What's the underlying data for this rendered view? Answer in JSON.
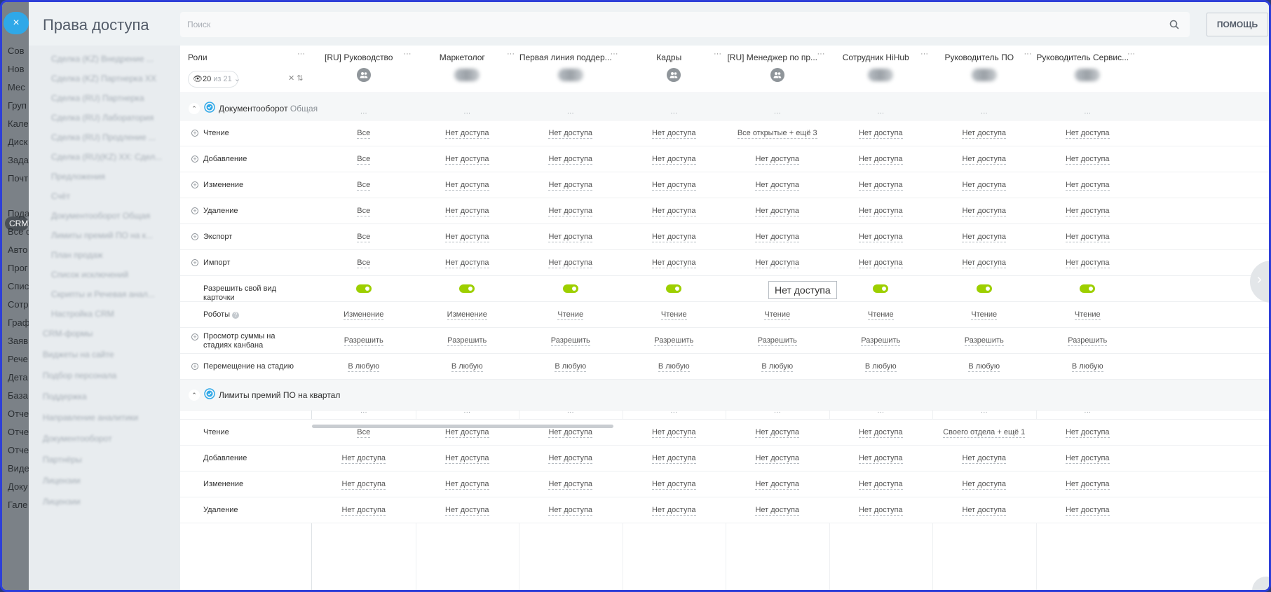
{
  "left_app": {
    "close_label": "×",
    "items": [
      "Сов",
      "Нов",
      "Мес",
      "Груп",
      "Кале",
      "Диск",
      "Зада",
      "Почт",
      "Пода",
      "Все с",
      "Авто",
      "Прог",
      "Спис",
      "Сотр",
      "Граф",
      "Заяв",
      "Рече",
      "Дета",
      "База",
      "Отче",
      "Отче",
      "Отче",
      "Виде",
      "Доку",
      "Гале"
    ],
    "crm_badge": "CRM"
  },
  "panel": {
    "title": "Права доступа"
  },
  "search": {
    "placeholder": "Поиск"
  },
  "help_button": "ПОМОЩЬ",
  "menu": {
    "items": [
      "Сделка (KZ) Внедрение ...",
      "Сделка (KZ) Партнерка XX",
      "Сделка (RU) Партнерка",
      "Сделка (RU) Лаборатория",
      "Сделка (RU) Продление ...",
      "Сделка (RU)(KZ) XX: Сдел...",
      "Предложения",
      "Счёт",
      "Документооборот Общая",
      "Лимиты премий ПО на к...",
      "План продаж",
      "Список исключений",
      "Скрипты и Речевая анал...",
      "Настройка CRM"
    ],
    "top_items": [
      "CRM-формы",
      "Виджеты на сайте",
      "Подбор персонала",
      "Поддержка",
      "Направление аналитики",
      "Документооборот",
      "Партнёры",
      "Лицензии",
      "Лицензии"
    ]
  },
  "table": {
    "roles_title": "Роли",
    "filter": {
      "count": "20",
      "of_label": "из 21"
    },
    "columns": [
      {
        "name": "[RU] Руководство",
        "avatar": "group"
      },
      {
        "name": "Маркетолог",
        "avatar": "blur"
      },
      {
        "name": "Первая линия поддер...",
        "avatar": "blur"
      },
      {
        "name": "Кадры",
        "avatar": "group"
      },
      {
        "name": "[RU] Менеджер по пр...",
        "avatar": "group"
      },
      {
        "name": "Сотрудник HiHub",
        "avatar": "blur"
      },
      {
        "name": "Руководитель ПО",
        "avatar": "blur"
      },
      {
        "name": "Руководитель Сервис...",
        "avatar": "blur"
      }
    ],
    "sections": [
      {
        "title": "Документооборот",
        "subtitle": "Общая",
        "rows": [
          {
            "label": "Чтение",
            "expandable": true,
            "values": [
              "Все",
              "Нет доступа",
              "Нет доступа",
              "Нет доступа",
              "Все открытые + ещё 3",
              "Нет доступа",
              "Нет доступа",
              "Нет доступа"
            ]
          },
          {
            "label": "Добавление",
            "expandable": true,
            "values": [
              "Все",
              "Нет доступа",
              "Нет доступа",
              "Нет доступа",
              "Нет доступа",
              "Нет доступа",
              "Нет доступа",
              "Нет доступа"
            ]
          },
          {
            "label": "Изменение",
            "expandable": true,
            "values": [
              "Все",
              "Нет доступа",
              "Нет доступа",
              "Нет доступа",
              "Нет доступа",
              "Нет доступа",
              "Нет доступа",
              "Нет доступа"
            ]
          },
          {
            "label": "Удаление",
            "expandable": true,
            "values": [
              "Все",
              "Нет доступа",
              "Нет доступа",
              "Нет доступа",
              "Нет доступа",
              "Нет доступа",
              "Нет доступа",
              "Нет доступа"
            ]
          },
          {
            "label": "Экспорт",
            "expandable": true,
            "values": [
              "Все",
              "Нет доступа",
              "Нет доступа",
              "Нет доступа",
              "Нет доступа",
              "Нет доступа",
              "Нет доступа",
              "Нет доступа"
            ]
          },
          {
            "label": "Импорт",
            "expandable": true,
            "values": [
              "Все",
              "Нет доступа",
              "Нет доступа",
              "Нет доступа",
              "Нет доступа",
              "Нет доступа",
              "Нет доступа",
              "Нет доступа"
            ]
          },
          {
            "label": "Разрешить свой вид карточки",
            "expandable": false,
            "toggle": true,
            "values": [
              "on",
              "on",
              "on",
              "on",
              "on",
              "on",
              "on",
              "on"
            ]
          },
          {
            "label": "Роботы",
            "expandable": false,
            "help": "?",
            "values": [
              "Изменение",
              "Изменение",
              "Чтение",
              "Чтение",
              "Чтение",
              "Чтение",
              "Чтение",
              "Чтение"
            ]
          },
          {
            "label": "Просмотр суммы на стадиях канбана",
            "expandable": true,
            "values": [
              "Разрешить",
              "Разрешить",
              "Разрешить",
              "Разрешить",
              "Разрешить",
              "Разрешить",
              "Разрешить",
              "Разрешить"
            ]
          },
          {
            "label": "Перемещение на стадию",
            "expandable": true,
            "values": [
              "В любую",
              "В любую",
              "В любую",
              "В любую",
              "В любую",
              "В любую",
              "В любую",
              "В любую"
            ]
          }
        ]
      },
      {
        "title": "Лимиты премий ПО на квартал",
        "subtitle": "",
        "rows": [
          {
            "label": "Чтение",
            "expandable": false,
            "values": [
              "Все",
              "Нет доступа",
              "Нет доступа",
              "Нет доступа",
              "Нет доступа",
              "Нет доступа",
              "Своего отдела + ещё 1",
              "Нет доступа"
            ]
          },
          {
            "label": "Добавление",
            "expandable": false,
            "values": [
              "Нет доступа",
              "Нет доступа",
              "Нет доступа",
              "Нет доступа",
              "Нет доступа",
              "Нет доступа",
              "Нет доступа",
              "Нет доступа"
            ]
          },
          {
            "label": "Изменение",
            "expandable": false,
            "values": [
              "Нет доступа",
              "Нет доступа",
              "Нет доступа",
              "Нет доступа",
              "Нет доступа",
              "Нет доступа",
              "Нет доступа",
              "Нет доступа"
            ]
          },
          {
            "label": "Удаление",
            "expandable": false,
            "values": [
              "Нет доступа",
              "Нет доступа",
              "Нет доступа",
              "Нет доступа",
              "Нет доступа",
              "Нет доступа",
              "Нет доступа",
              "Нет доступа"
            ]
          }
        ]
      }
    ]
  },
  "tooltip": {
    "text": "Нет доступа"
  },
  "colors": {
    "accent": "#2fa8e8",
    "toggle_on": "#9dcf00",
    "frame": "#2e3fd8"
  },
  "icons": {
    "search": "search-icon",
    "group": "group-icon",
    "section": "section-check-icon",
    "next": "chevron-right-icon"
  }
}
